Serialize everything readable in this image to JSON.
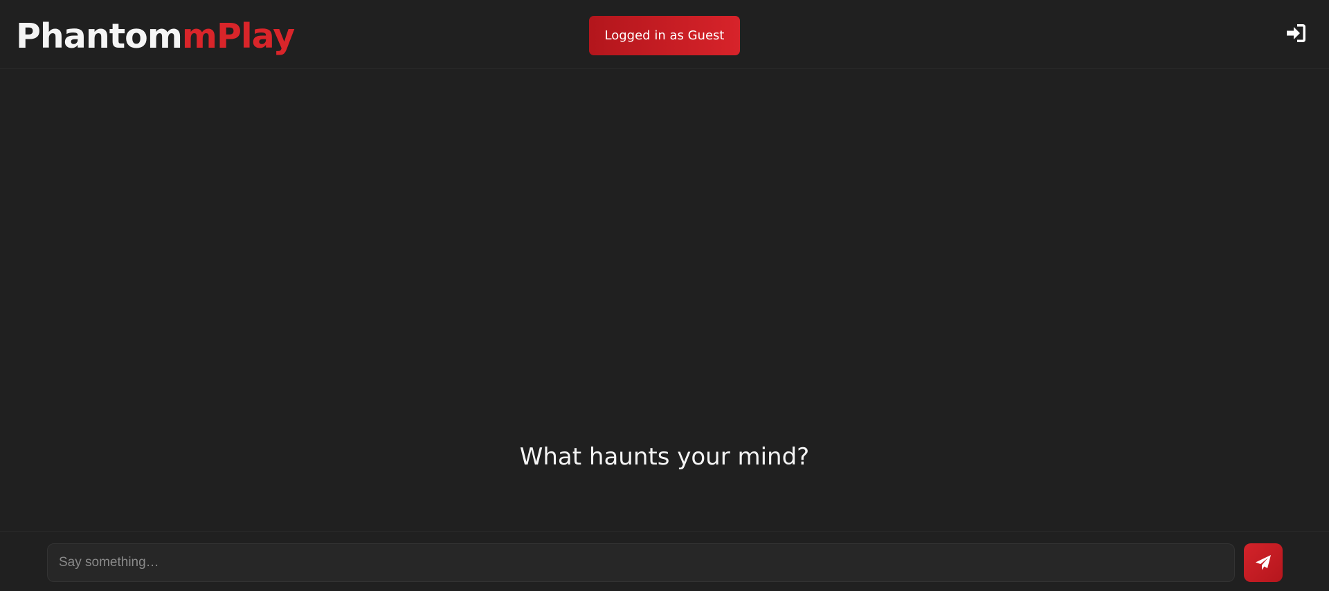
{
  "header": {
    "brand_part1": "Phantom",
    "brand_part2": "mPlay",
    "guest_status": "Logged in as Guest",
    "login_icon": "sign-in-icon"
  },
  "main": {
    "prompt": "What haunts your mind?"
  },
  "composer": {
    "placeholder": "Say something…",
    "value": "",
    "send_icon": "paper-plane-icon"
  },
  "colors": {
    "background": "#202020",
    "accent": "#d7232a",
    "accent_dark": "#b3161c",
    "text": "#f2f2f2"
  }
}
